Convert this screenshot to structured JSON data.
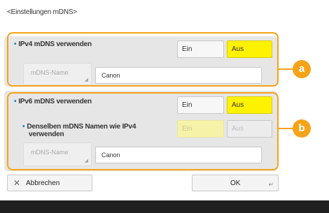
{
  "screen_title": "<Einstellungen mDNS>",
  "ipv4": {
    "label": "IPv4 mDNS verwenden",
    "on_label": "Ein",
    "off_label": "Aus",
    "selected": "Aus",
    "name_label": "mDNS-Name",
    "name_value": "Canon"
  },
  "ipv6": {
    "label": "IPv6 mDNS verwenden",
    "on_label": "Ein",
    "off_label": "Aus",
    "selected": "Aus",
    "same_name_label_line1": "Denselben mDNS Namen wie IPv4",
    "same_name_label_line2": "verwenden",
    "same_on_label": "Ein",
    "same_off_label": "Aus",
    "name_label": "mDNS-Name",
    "name_value": "Canon"
  },
  "callouts": {
    "a": "a",
    "b": "b"
  },
  "footer": {
    "cancel_label": "Abbrechen",
    "ok_label": "OK"
  },
  "colors": {
    "accent": "#f5a318",
    "selected": "#fff200",
    "bullet": "#0a7fc0"
  }
}
